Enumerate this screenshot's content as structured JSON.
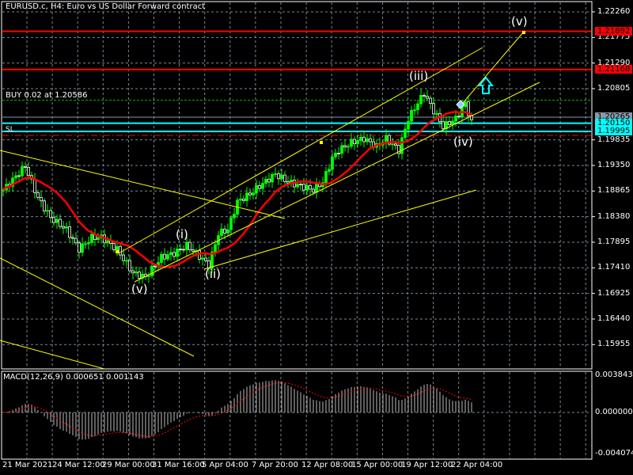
{
  "header": {
    "title": "EURUSD.c, H4:  Euro vs US Dollar Forward contract"
  },
  "order": {
    "buy_label": "BUY 0.02 at 1.20586",
    "sl_label": "SL"
  },
  "price_axis": [
    "1.22260",
    "1.21775",
    "1.21290",
    "1.20805",
    "1.19835",
    "1.19350",
    "1.18865",
    "1.18380",
    "1.17895",
    "1.17410",
    "1.16925",
    "1.16440",
    "1.15955"
  ],
  "price_tags": [
    {
      "text": "1.21892",
      "bg": "#ff0000",
      "fg": "#000000"
    },
    {
      "text": "1.21168",
      "bg": "#ff0000",
      "fg": "#000000"
    },
    {
      "text": "1.20265",
      "bg": "#8899aa",
      "fg": "#000000"
    },
    {
      "text": "1.20150",
      "bg": "#00ffff",
      "fg": "#000000"
    },
    {
      "text": "1.19995",
      "bg": "#00ffff",
      "fg": "#000000"
    }
  ],
  "time_axis": [
    "21 Mar 2021",
    "24 Mar 12:00",
    "29 Mar 00:00",
    "31 Mar 16:00",
    "5 Apr 04:00",
    "7 Apr 20:00",
    "12 Apr 08:00",
    "15 Apr 00:00",
    "19 Apr 12:00",
    "22 Apr 04:00"
  ],
  "waves": [
    "(v)",
    "(i)",
    "(ii)",
    "(iii)",
    "(iv)",
    "(v)"
  ],
  "macd": {
    "label": "MACD(12,26,9) 0.000651 0.001143",
    "axis": [
      "0.003843",
      "0.000000",
      "-0.004074"
    ]
  },
  "chart_data": {
    "type": "candlestick",
    "symbol": "EURUSD.c",
    "timeframe": "H4",
    "ylim": [
      1.1547,
      1.2245
    ],
    "levels": {
      "red": [
        1.21892,
        1.21168
      ],
      "buy": 1.20586,
      "bid": 1.20265,
      "cyan": [
        1.2015,
        1.19995
      ]
    },
    "key_closes": [
      [
        0,
        1.18885
      ],
      [
        7,
        1.19335
      ],
      [
        11,
        1.18735
      ],
      [
        15,
        1.1836
      ],
      [
        20,
        1.18135
      ],
      [
        24,
        1.1776
      ],
      [
        28,
        1.17985
      ],
      [
        31,
        1.17985
      ],
      [
        36,
        1.1776
      ],
      [
        41,
        1.1731
      ],
      [
        45,
        1.17235
      ],
      [
        50,
        1.1761
      ],
      [
        54,
        1.17685
      ],
      [
        58,
        1.17835
      ],
      [
        61,
        1.17685
      ],
      [
        65,
        1.1746
      ],
      [
        68,
        1.1806
      ],
      [
        71,
        1.18135
      ],
      [
        74,
        1.1866
      ],
      [
        78,
        1.1881
      ],
      [
        81,
        1.1896
      ],
      [
        86,
        1.19185
      ],
      [
        90,
        1.19035
      ],
      [
        94,
        1.1896
      ],
      [
        98,
        1.18885
      ],
      [
        101,
        1.19035
      ],
      [
        104,
        1.19485
      ],
      [
        106,
        1.19635
      ],
      [
        110,
        1.19785
      ],
      [
        114,
        1.1986
      ],
      [
        118,
        1.1971
      ],
      [
        121,
        1.1986
      ],
      [
        125,
        1.19635
      ],
      [
        128,
        1.20235
      ],
      [
        131,
        1.20535
      ],
      [
        133,
        1.20715
      ],
      [
        136,
        1.20385
      ],
      [
        139,
        1.20085
      ],
      [
        143,
        1.20235
      ],
      [
        146,
        1.20535
      ],
      [
        148,
        1.2016
      ]
    ],
    "macd": {
      "fast": 12,
      "slow": 26,
      "signal": 9,
      "value": 0.000651,
      "signal_value": 0.001143,
      "ylim": [
        -0.004074,
        0.003843
      ]
    }
  }
}
